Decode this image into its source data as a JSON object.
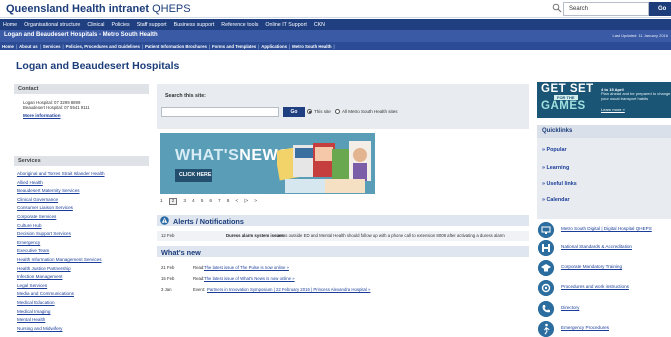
{
  "header": {
    "title_main": "Queensland Health intranet",
    "title_suffix": "QHEPS",
    "search_placeholder": "Search",
    "go_label": "Go"
  },
  "main_nav": [
    "Home",
    "Organisational structure",
    "Clinical",
    "Policies",
    "Staff support",
    "Business support",
    "Reference tools",
    "Online IT Support",
    "CKN"
  ],
  "site_bar": {
    "name": "Logan and Beaudesert Hospitals - Metro South Health",
    "updated": "Last Updated: 11 January 2016"
  },
  "sub_nav": [
    "Home",
    "About us",
    "Services",
    "Policies, Procedures and Guidelines",
    "Patient Information Brochures",
    "Forms and Templates",
    "Applications",
    "Metro South Health"
  ],
  "page_title": "Logan and Beaudesert Hospitals",
  "contact": {
    "heading": "Contact",
    "lines": [
      "Logan Hospital: 07 3299 8899",
      "Beaudesert Hospital: 07 5541 9111"
    ],
    "more": "More information"
  },
  "services": {
    "heading": "Services",
    "items": [
      "Aboriginal and Torres Strait Islander Health",
      "Allied Health",
      "Beaudesert Maternity Services",
      "Clinical Governance",
      "Consumer Liaison Services",
      "Corporate Services",
      "Culture Hub",
      "Decision Support Services",
      "Emergency",
      "Executive Team",
      "Health Information Management Services",
      "Health Justice Partnership",
      "Infection Management",
      "Legal Services",
      "Media and Communications",
      "Medical Education",
      "Medical Imaging",
      "Mental Health",
      "Nursing and Midwifery"
    ]
  },
  "site_search": {
    "label": "Search this site:",
    "go_label": "Go",
    "option_this_site": "This site",
    "option_all": "All Metro South Health sites"
  },
  "banner": {
    "word_light": "WHAT'S",
    "word_bold": "NEWS",
    "click_label": "CLICK HERE"
  },
  "pager": [
    "1",
    "2",
    "3",
    "4",
    "5",
    "6",
    "7",
    "8",
    "<",
    "|>",
    ">"
  ],
  "alerts": {
    "heading": "Alerts / Notifications",
    "date": "12 Feb",
    "title": "Duress alarm system issues",
    "text": "- areas outside ED and Mental Health should follow up with a phone call to extension 8008 after activating a duress alarm"
  },
  "whats_new": {
    "heading": "What's new",
    "items": [
      {
        "date": "21 Feb",
        "kind": "Read:",
        "link": "The latest issue of The Pulse is now online »"
      },
      {
        "date": "15 Feb",
        "kind": "Read:",
        "link": "The latest issue of What's News is now online »"
      },
      {
        "date": "3 Jan",
        "kind": "Event:",
        "link": "Partners in Innovation Symposium | 22 February 2016 | Princess Alexandra Hospital »"
      }
    ]
  },
  "get_set": {
    "get": "GET SET",
    "for_the": "FOR THE",
    "games": "GAMES",
    "date": "4 to 15 April",
    "text": "Plan ahead and be prepared to change your usual transport habits",
    "learn": "Learn more »"
  },
  "quicklinks": {
    "heading": "Quicklinks",
    "items": [
      "Popular",
      "Learning",
      "Useful links",
      "Calendar"
    ]
  },
  "resource_links": [
    "Metro South Digital | Digital Hospital QHEPS",
    "National Standards & Accreditation",
    "Corporate Mandatory Training",
    "Procedures and work instructions",
    "Directory",
    "Emergency Procedures"
  ],
  "colors": {
    "navy": "#1f3f80",
    "sitebar": "#3a5aa6",
    "link": "#1a3d9a",
    "banner": "#5a9db7",
    "getset": "#1a5575"
  }
}
